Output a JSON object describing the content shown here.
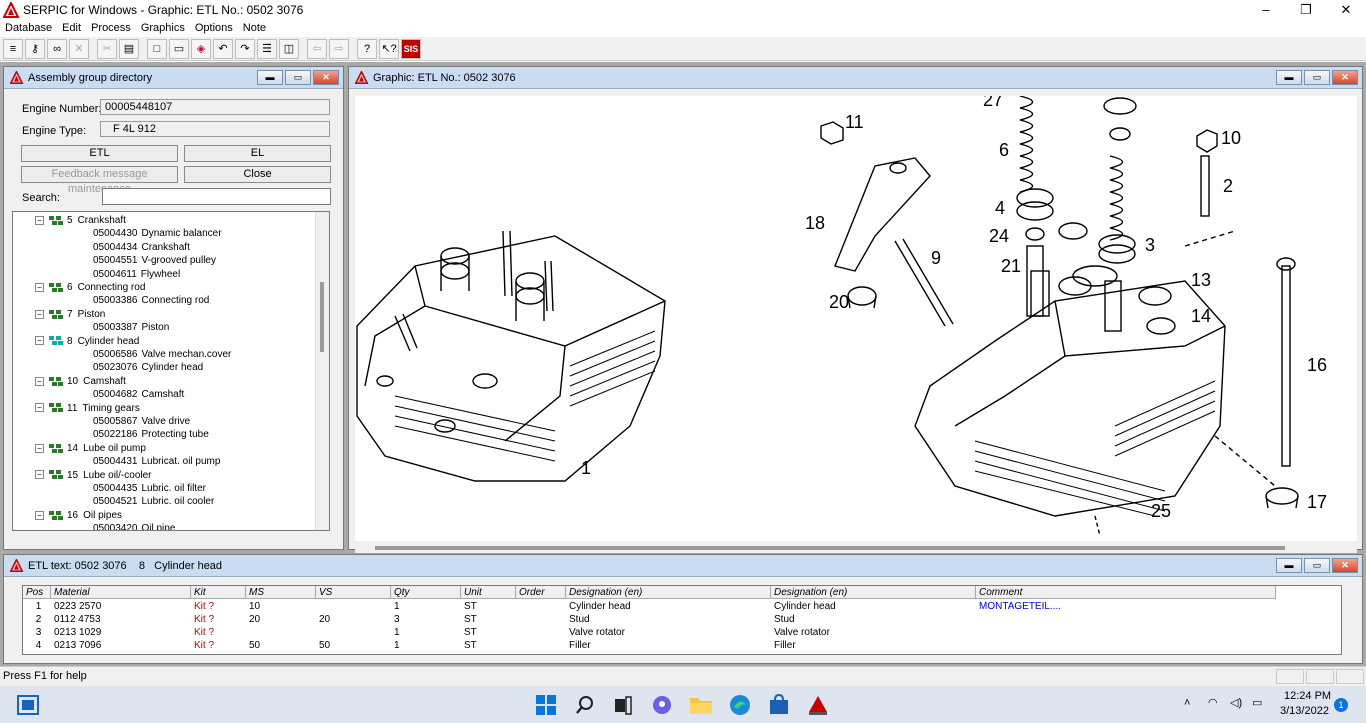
{
  "app": {
    "title": "SERPIC for Windows - Graphic: ETL No.: 0502 3076",
    "controls": [
      "–",
      "❐",
      "✕"
    ]
  },
  "menu": [
    "Database",
    "Edit",
    "Process",
    "Graphics",
    "Options",
    "Note"
  ],
  "toolbar": {
    "buttons": [
      "db-icon",
      "key-icon",
      "link-icon",
      "cross-icon",
      "scissors-icon",
      "print-icon",
      "new-page-icon",
      "open-folder-icon",
      "color-icon",
      "undo-icon",
      "redo-icon",
      "list-icon",
      "list2-icon",
      "back-icon",
      "forward-icon",
      "help-icon",
      "context-help-icon"
    ],
    "sis_label": "SIS"
  },
  "assembly": {
    "title": "Assembly group directory",
    "engine_number_label": "Engine Number:",
    "engine_number": "00005448107",
    "engine_type_label": "Engine Type:",
    "engine_type": "F 4L 912",
    "etl_button": "ETL",
    "el_button": "EL",
    "feedback_button": "Feedback message maintenance",
    "close_button": "Close",
    "search_label": "Search:",
    "tree": [
      {
        "kind": "group",
        "num": "5",
        "label": "Crankshaft"
      },
      {
        "kind": "item",
        "code": "05004430",
        "label": "Dynamic balancer"
      },
      {
        "kind": "item",
        "code": "05004434",
        "label": "Crankshaft"
      },
      {
        "kind": "item",
        "code": "05004551",
        "label": "V-grooved pulley"
      },
      {
        "kind": "item",
        "code": "05004611",
        "label": "Flywheel"
      },
      {
        "kind": "group",
        "num": "6",
        "label": "Connecting rod"
      },
      {
        "kind": "item",
        "code": "05003386",
        "label": "Connecting rod"
      },
      {
        "kind": "group",
        "num": "7",
        "label": "Piston"
      },
      {
        "kind": "item",
        "code": "05003387",
        "label": "Piston"
      },
      {
        "kind": "group",
        "num": "8",
        "label": "Cylinder head",
        "active": true
      },
      {
        "kind": "item",
        "code": "05006586",
        "label": "Valve mechan.cover"
      },
      {
        "kind": "item",
        "code": "05023076",
        "label": "Cylinder head"
      },
      {
        "kind": "group",
        "num": "10",
        "label": "Camshaft"
      },
      {
        "kind": "item",
        "code": "05004682",
        "label": "Camshaft"
      },
      {
        "kind": "group",
        "num": "11",
        "label": "Timing gears"
      },
      {
        "kind": "item",
        "code": "05005867",
        "label": "Valve drive"
      },
      {
        "kind": "item",
        "code": "05022186",
        "label": "Protecting tube"
      },
      {
        "kind": "group",
        "num": "14",
        "label": "Lube oil pump"
      },
      {
        "kind": "item",
        "code": "05004431",
        "label": "Lubricat. oil pump"
      },
      {
        "kind": "group",
        "num": "15",
        "label": "Lube oil/-cooler"
      },
      {
        "kind": "item",
        "code": "05004435",
        "label": "Lubric. oil filter"
      },
      {
        "kind": "item",
        "code": "05004521",
        "label": "Lubric. oil cooler"
      },
      {
        "kind": "group",
        "num": "16",
        "label": "Oil pipes"
      },
      {
        "kind": "item",
        "code": "05003420",
        "label": "Oil pipe"
      }
    ]
  },
  "graphic": {
    "title": "Graphic: ETL No.: 0502 3076",
    "callouts": [
      "27",
      "11",
      "6",
      "10",
      "2",
      "18",
      "4",
      "24",
      "3",
      "9",
      "21",
      "13",
      "20",
      "14",
      "16",
      "1",
      "17",
      "25"
    ]
  },
  "etl": {
    "title": "ETL text: 0502 3076    8   Cylinder head",
    "columns": [
      "Pos",
      "Material",
      "Kit",
      "MS",
      "VS",
      "Qty",
      "Unit",
      "Order",
      "Designation (en)",
      "Designation (en)",
      "Comment"
    ],
    "rows": [
      [
        "1",
        "0223 2570",
        "Kit ?",
        "10",
        "",
        "1",
        "ST",
        "",
        "Cylinder head",
        "Cylinder head",
        "MONTAGETEIL...."
      ],
      [
        "2",
        "0112 4753",
        "Kit ?",
        "20",
        "20",
        "3",
        "ST",
        "",
        "Stud",
        "Stud",
        ""
      ],
      [
        "3",
        "0213 1029",
        "Kit ?",
        "",
        "",
        "1",
        "ST",
        "",
        "Valve rotator",
        "Valve rotator",
        ""
      ],
      [
        "4",
        "0213 7096",
        "Kit ?",
        "50",
        "50",
        "1",
        "ST",
        "",
        "Filler",
        "Filler",
        ""
      ]
    ]
  },
  "status": {
    "text": "Press F1 for help"
  },
  "taskbar": {
    "icons": [
      "windows-start-icon",
      "search-icon",
      "task-view-icon",
      "chat-icon",
      "file-explorer-icon",
      "edge-icon",
      "store-icon",
      "deutz-icon"
    ],
    "time": "12:24 PM",
    "date": "3/13/2022",
    "notifications": "1"
  }
}
